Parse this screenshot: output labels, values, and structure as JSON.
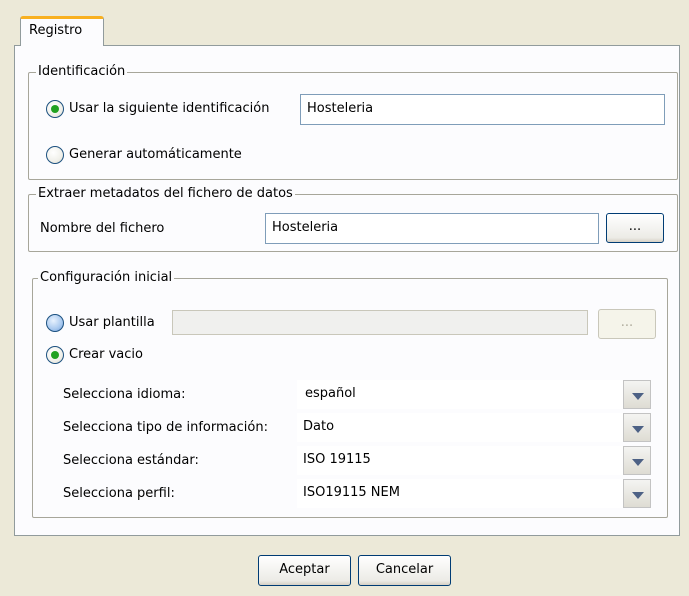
{
  "tab": {
    "label": "Registro"
  },
  "identification": {
    "legend": "Identificación",
    "option_use": "Usar la siguiente identificación",
    "id_value": "Hosteleria",
    "option_auto": "Generar automáticamente"
  },
  "extract": {
    "legend": "Extraer metadatos del fichero de datos",
    "file_label": "Nombre del fichero",
    "file_value": "Hosteleria",
    "browse_label": "..."
  },
  "config": {
    "legend": "Configuración inicial",
    "option_template": "Usar plantilla",
    "template_value": "",
    "template_browse": "...",
    "option_empty": "Crear vacio",
    "rows": [
      {
        "label": "Selecciona idioma:",
        "value": "español"
      },
      {
        "label": "Selecciona tipo de información:",
        "value": "Dato"
      },
      {
        "label": "Selecciona estándar:",
        "value": "ISO 19115"
      },
      {
        "label": "Selecciona perfil:",
        "value": "ISO19115 NEM"
      }
    ]
  },
  "footer": {
    "accept": "Aceptar",
    "cancel": "Cancelar"
  },
  "colors": {
    "tab_accent": "#f8b020",
    "radio_selected": "#21a121",
    "window_bg": "#ece9d8"
  }
}
